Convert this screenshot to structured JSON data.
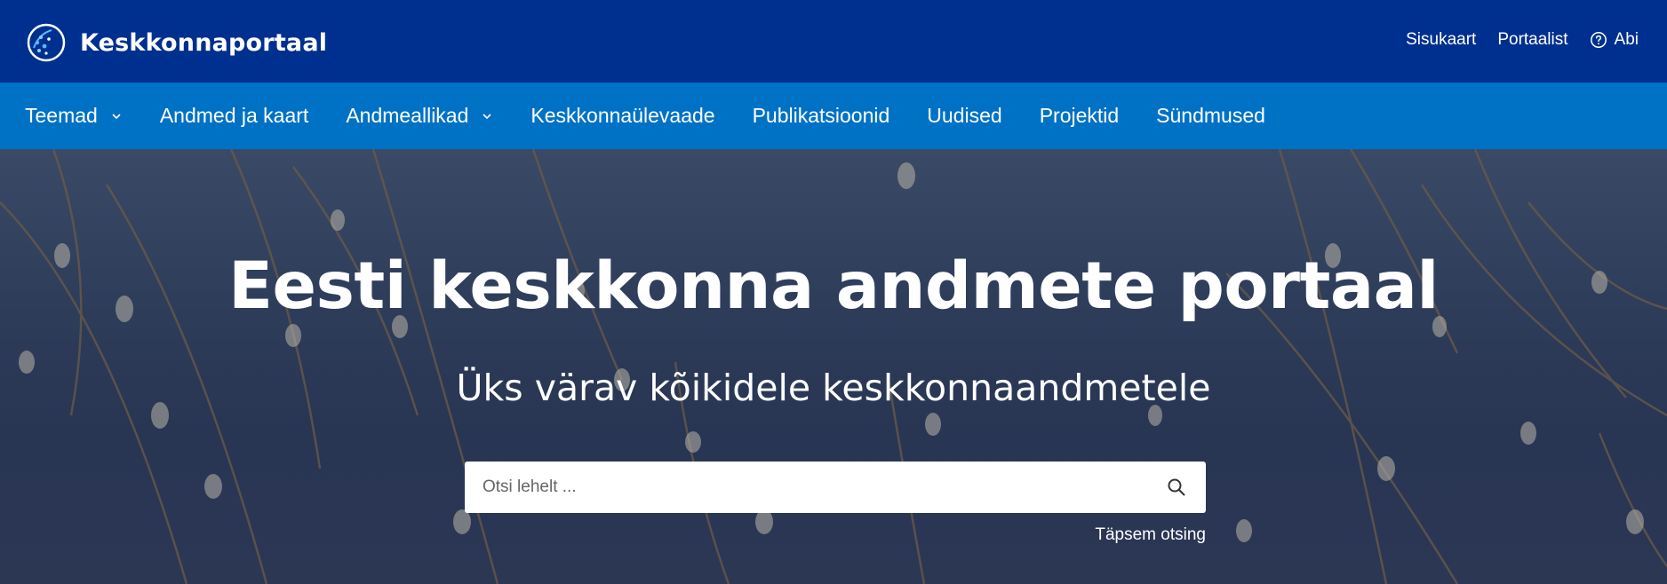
{
  "header": {
    "site_name": "Keskkonnaportaal",
    "utility_links": [
      {
        "label": "Sisukaart"
      },
      {
        "label": "Portaalist"
      },
      {
        "label": "Abi",
        "icon": "question-circle-icon"
      }
    ]
  },
  "nav": {
    "items": [
      {
        "label": "Teemad",
        "has_dropdown": true
      },
      {
        "label": "Andmed ja kaart",
        "has_dropdown": false
      },
      {
        "label": "Andmeallikad",
        "has_dropdown": true
      },
      {
        "label": "Keskkonnaülevaade",
        "has_dropdown": false
      },
      {
        "label": "Publikatsioonid",
        "has_dropdown": false
      },
      {
        "label": "Uudised",
        "has_dropdown": false
      },
      {
        "label": "Projektid",
        "has_dropdown": false
      },
      {
        "label": "Sündmused",
        "has_dropdown": false
      }
    ]
  },
  "hero": {
    "title": "Eesti keskkonna andmete portaal",
    "subtitle": "Üks värav kõikidele keskkonnaandmetele",
    "search": {
      "placeholder": "Otsi lehelt ...",
      "value": ""
    },
    "advanced_search_label": "Täpsem otsing"
  },
  "colors": {
    "topbar": "#00308f",
    "nav": "#0072c6",
    "hero_overlay": "#2e3d5a"
  }
}
